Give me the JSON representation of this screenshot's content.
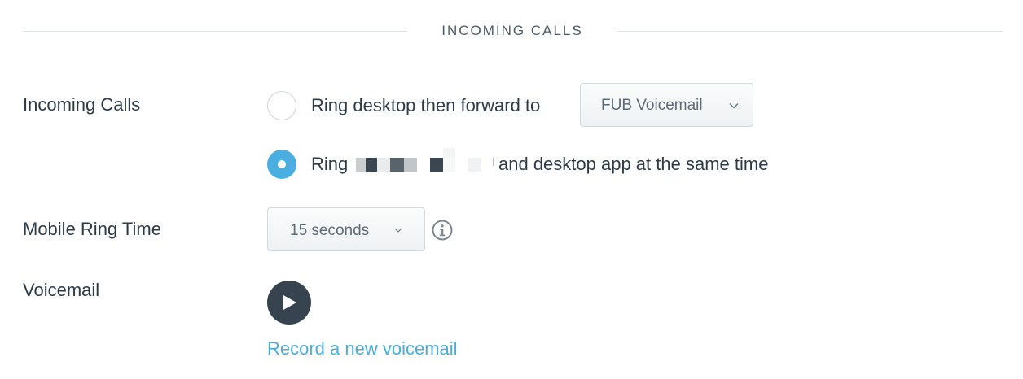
{
  "section": {
    "title": "INCOMING CALLS"
  },
  "incoming_calls": {
    "label": "Incoming Calls",
    "options": [
      {
        "text": "Ring desktop then forward to",
        "selected": false,
        "forward_dropdown_value": "FUB Voicemail",
        "forward_dropdown_icon": "chevron-down-icon"
      },
      {
        "text_before": "Ring",
        "redacted_icon": "redacted-phone-number",
        "text_after": "and desktop app at the same time",
        "selected": true
      }
    ]
  },
  "mobile_ring_time": {
    "label": "Mobile Ring Time",
    "value": "15 seconds",
    "dropdown_icon": "chevron-down-icon",
    "help_icon": "info-icon"
  },
  "voicemail": {
    "label": "Voicemail",
    "play_icon": "play-icon",
    "record_link": "Record a new voicemail"
  },
  "colors": {
    "accent": "#4aaee0",
    "link": "#4aaed9",
    "text": "#2c3b47",
    "play_button": "#37444f",
    "divider": "#dfe3e6"
  }
}
